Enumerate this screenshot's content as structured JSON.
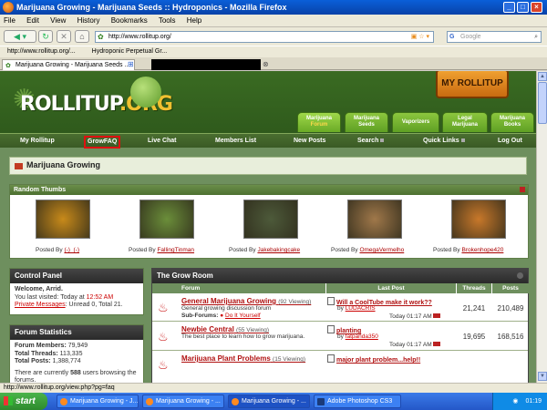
{
  "browser": {
    "title": "Marijuana Growing - Marijuana Seeds :: Hydroponics - Mozilla Firefox",
    "menu": [
      "File",
      "Edit",
      "View",
      "History",
      "Bookmarks",
      "Tools",
      "Help"
    ],
    "url": "http://www.rollitup.org/",
    "search_placeholder": "Google",
    "bookmarks": [
      "http://www.rollitup.org/...",
      "Hydroponic Perpetual Gr..."
    ],
    "tabs": [
      "Marijuana Growing - Marijuana Seeds ...",
      ""
    ],
    "status": "http://www.rollitup.org/view.php?pg=faq",
    "window_buttons": [
      "_",
      "□",
      "×"
    ]
  },
  "site": {
    "logo_main": "ROLLITUP",
    "logo_org": ".ORG",
    "my_rollitup": "MY ROLLITUP",
    "header_tabs": [
      {
        "l1": "Marijuana",
        "l2": "Forum"
      },
      {
        "l1": "Marijuana",
        "l2": "Seeds"
      },
      {
        "l1": "Vaporizers",
        "l2": ""
      },
      {
        "l1": "Legal",
        "l2": "Marijuana"
      },
      {
        "l1": "Marijuana",
        "l2": "Books"
      }
    ],
    "nav": [
      "My Rollitup",
      "GrowFAQ",
      "Live Chat",
      "Members List",
      "New Posts",
      "Search",
      "Quick Links",
      "Log Out"
    ]
  },
  "page": {
    "breadcrumb": "Marijuana Growing",
    "random_thumbs": {
      "title": "Random Thumbs",
      "posted_by": "Posted By",
      "items": [
        {
          "user": "(-)_(-)",
          "color": "#c88a1a"
        },
        {
          "user": "FallingTinman",
          "color": "#6b8e3a"
        },
        {
          "user": "Jakebakingcake",
          "color": "#4d5a3a"
        },
        {
          "user": "OmegaVermelho",
          "color": "#a0784a"
        },
        {
          "user": "Brokenhope420",
          "color": "#c8782a"
        }
      ]
    },
    "control_panel": {
      "title": "Control Panel",
      "welcome": "Welcome, Arrid.",
      "last_visited_label": "You last visited: Today at ",
      "last_visited_time": "12:52 AM",
      "pm_label": "Private Messages",
      "pm_counts": ": Unread 0, Total 21."
    },
    "forum_stats": {
      "title": "Forum Statistics",
      "members_label": "Forum Members:",
      "members": "79,949",
      "threads_label": "Total Threads:",
      "threads": "113,335",
      "posts_label": "Total Posts:",
      "posts": "1,388,774",
      "currently_pre": "There are currently ",
      "currently_num": "588",
      "currently_post": " users browsing the forums."
    },
    "grow_room": {
      "title": "The Grow Room",
      "columns": [
        "Forum",
        "Last Post",
        "Threads",
        "Posts"
      ],
      "forums": [
        {
          "name": "General Marijuana Growing",
          "viewing": "(92 Viewing)",
          "desc": "General growing discussion forum",
          "sub_label": "Sub-Forums:",
          "sub": "Do It Yourself",
          "last_title": "Will a CoolTube make it work??",
          "last_by_label": "by",
          "last_by": "LUDACRIS",
          "last_time": "Today 01:17 AM",
          "threads": "21,241",
          "posts": "210,489"
        },
        {
          "name": "Newbie Central",
          "viewing": "(55 Viewing)",
          "desc": "The best place to learn how to grow marijuana.",
          "sub_label": "",
          "sub": "",
          "last_title": "planting",
          "last_by_label": "by",
          "last_by": "fatpanda350",
          "last_time": "Today 01:17 AM",
          "threads": "19,695",
          "posts": "168,516"
        },
        {
          "name": "Marijuana Plant Problems",
          "viewing": "(15 Viewing)",
          "desc": "",
          "sub_label": "",
          "sub": "",
          "last_title": "major plant problem...help!!",
          "last_by_label": "",
          "last_by": "",
          "last_time": "",
          "threads": "",
          "posts": ""
        }
      ]
    }
  },
  "taskbar": {
    "start": "start",
    "tasks": [
      "Marijuana Growing - J...",
      "Marijuana Growing - ...",
      "Marijuana Growing - ...",
      "Adobe Photoshop CS3"
    ],
    "clock": "01:19"
  }
}
